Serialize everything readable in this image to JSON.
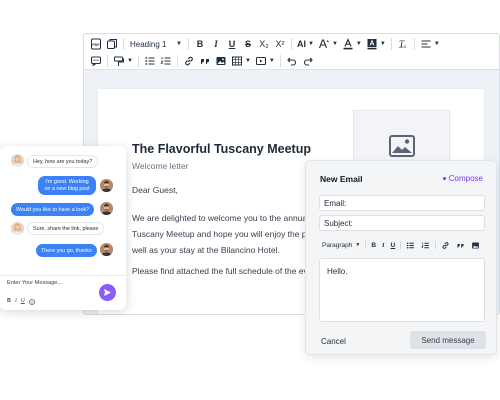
{
  "editor": {
    "toolbar": {
      "block_format": "Heading 1",
      "bold": "B",
      "italic": "I",
      "underline": "U",
      "strikethrough": "S",
      "subscript": "X₂",
      "superscript": "X²",
      "font_size": "AI",
      "clear_formatting": "T̲ₓ"
    },
    "document": {
      "title": "The Flavorful Tuscany Meetup",
      "subtitle": "Welcome letter",
      "greeting": "Dear Guest,",
      "line1": "We are delighted to welcome you to the annual F",
      "line2": "Tuscany Meetup and hope you will enjoy the pro",
      "line3": "well as your stay at the Bilancino Hotel.",
      "line4": "Please find attached the full schedule of the eve"
    }
  },
  "chat": {
    "messages": [
      {
        "side": "in",
        "text": "Hey, how are you today?"
      },
      {
        "side": "out",
        "text": "I'm good. Working on a new blog post"
      },
      {
        "side": "out",
        "text": "Would you like to have a look?"
      },
      {
        "side": "in",
        "text": "Sure, share the link, please"
      },
      {
        "side": "out",
        "text": "There you go, thanks"
      }
    ],
    "input_placeholder": "Enter Your Message...",
    "tools": {
      "bold": "B",
      "italic": "I",
      "underline": "U"
    }
  },
  "email": {
    "title": "New Email",
    "compose_label": "Compose",
    "email_label": "Email:",
    "subject_label": "Subject:",
    "toolbar": {
      "block_format": "Paragraph",
      "bold": "B",
      "italic": "I",
      "underline": "U"
    },
    "body": "Hello.",
    "cancel_label": "Cancel",
    "send_label": "Send message"
  },
  "colors": {
    "accent_purple": "#8b5cf6",
    "chat_blue": "#3b82f6",
    "compose_purple": "#7c3aed"
  }
}
